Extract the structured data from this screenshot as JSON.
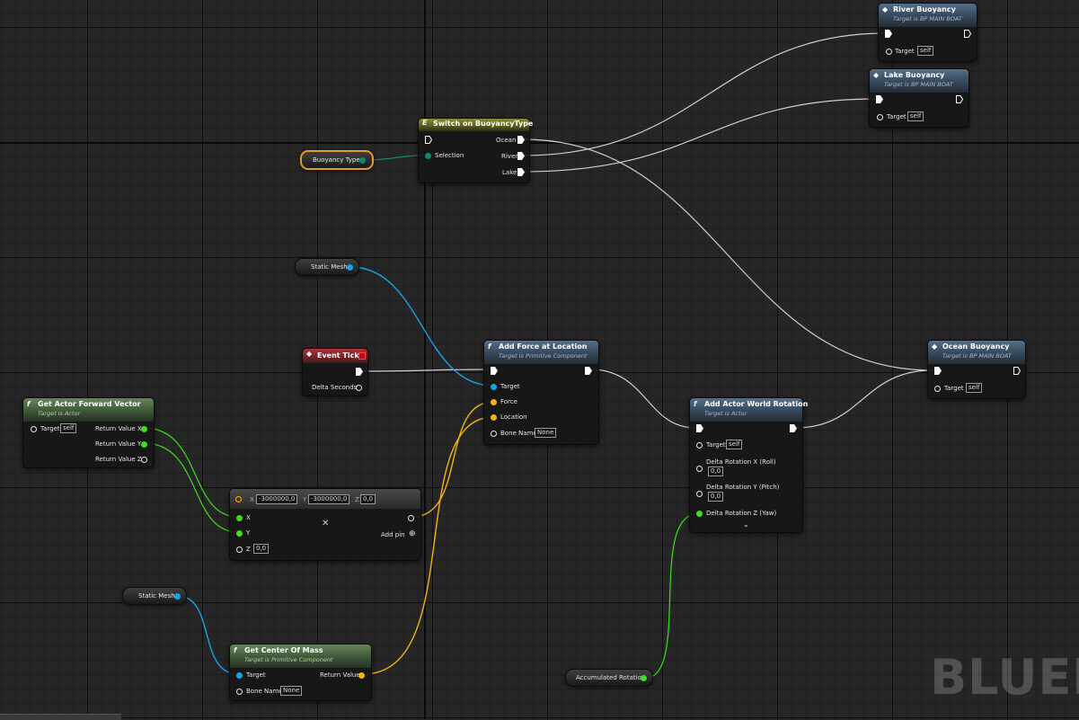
{
  "watermark": "BLUEPR",
  "nodes": {
    "river_buoyancy": {
      "title": "River Buoyancy",
      "subtitle": "Target is BP MAIN BOAT",
      "target_label": "Target",
      "target_value": "self"
    },
    "lake_buoyancy": {
      "title": "Lake Buoyancy",
      "subtitle": "Target is BP MAIN BOAT",
      "target_label": "Target",
      "target_value": "self"
    },
    "switch": {
      "title": "Switch on BuoyancyType",
      "selection": "Selection",
      "ocean": "Ocean",
      "river": "River",
      "lake": "Lake"
    },
    "buoyancy_type_var": {
      "label": "Buoyancy Type"
    },
    "static_mesh_1": {
      "label": "Static Mesh"
    },
    "static_mesh_2": {
      "label": "Static Mesh"
    },
    "event_tick": {
      "title": "Event Tick",
      "delta": "Delta Seconds"
    },
    "add_force": {
      "title": "Add Force at Location",
      "subtitle": "Target is Primitive Component",
      "target": "Target",
      "force": "Force",
      "location": "Location",
      "bone_name": "Bone Name",
      "bone_value": "None"
    },
    "ocean_buoyancy": {
      "title": "Ocean Buoyancy",
      "subtitle": "Target is BP MAIN BOAT",
      "target_label": "Target",
      "target_value": "self"
    },
    "get_forward": {
      "title": "Get Actor Forward Vector",
      "subtitle": "Target is Actor",
      "target_label": "Target",
      "target_value": "self",
      "rx": "Return Value X",
      "ry": "Return Value Y",
      "rz": "Return Value Z"
    },
    "make_vector": {
      "x_label": "X",
      "x_value": "-3000000,0",
      "y_label": "Y",
      "y_value": "-3000000,0",
      "z_label": "Z",
      "z_value": "0,0",
      "pin_x": "X",
      "pin_y": "Y",
      "pin_z": "Z",
      "pin_z_value": "0,0",
      "add_pin": "Add pin"
    },
    "add_rotation": {
      "title": "Add Actor World Rotation",
      "subtitle": "Target is Actor",
      "target_label": "Target",
      "target_value": "self",
      "roll": "Delta Rotation X (Roll)",
      "roll_value": "0,0",
      "pitch": "Delta Rotation Y (Pitch)",
      "pitch_value": "0,0",
      "yaw": "Delta Rotation Z (Yaw)"
    },
    "get_com": {
      "title": "Get Center Of Mass",
      "subtitle": "Target is Primitive Component",
      "target": "Target",
      "bone_name": "Bone Name",
      "bone_value": "None",
      "return_value": "Return Value"
    },
    "accumulated_rotation": {
      "label": "Accumulated Rotation"
    }
  },
  "colors": {
    "exec": "#ffffff",
    "object": "#1aa1e6",
    "float": "#3be01b",
    "vector": "#f0b319",
    "name": "#a66ee3",
    "enum": "#0f8a73",
    "selection_outline": "#e39a2b"
  },
  "icons": [
    "function-icon",
    "event-icon",
    "switch-icon",
    "chevron-down-icon",
    "close-icon",
    "add-pin-icon",
    "delegate-icon"
  ]
}
